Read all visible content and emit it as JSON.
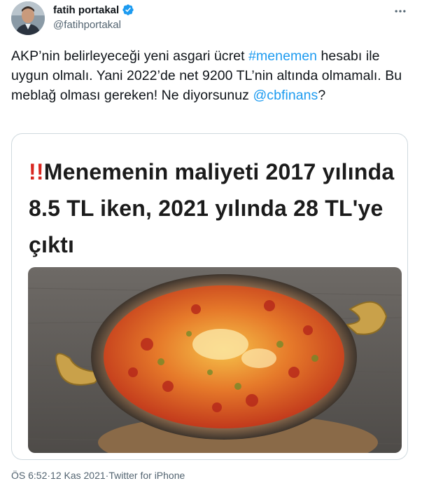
{
  "author": {
    "display_name": "fatih portakal",
    "handle": "@fatihportakal",
    "verified": true,
    "avatar_icon": "avatar-photo",
    "more_icon": "more-options-icon"
  },
  "tweet": {
    "text_1": "AKP’nin belirleyeceği yeni asgari ücret ",
    "hashtag": "#menemen",
    "text_2": " hesabı ile uygun olmalı. Yani 2022’de net 9200 TL’nin altında olmamalı. Bu meblağ olması gereken! Ne diyorsunuz ",
    "mention": "@cbfinans",
    "text_3": "?"
  },
  "media": {
    "bang": "!!",
    "headline": "Menemenin maliyeti 2017 yılında 8.5 TL iken, 2021 yılında 28 TL'ye çıktı",
    "photo": "menemen-pan-photo"
  },
  "meta": {
    "time": "ÖS 6:52",
    "sep1": " · ",
    "date": "12 Kas 2021",
    "sep2": " · ",
    "source": "Twitter for iPhone"
  },
  "colors": {
    "link": "#1d9bf0",
    "text": "#0f1419",
    "secondary": "#536471",
    "verified": "#1d9bf0",
    "bang": "#d8261f"
  }
}
